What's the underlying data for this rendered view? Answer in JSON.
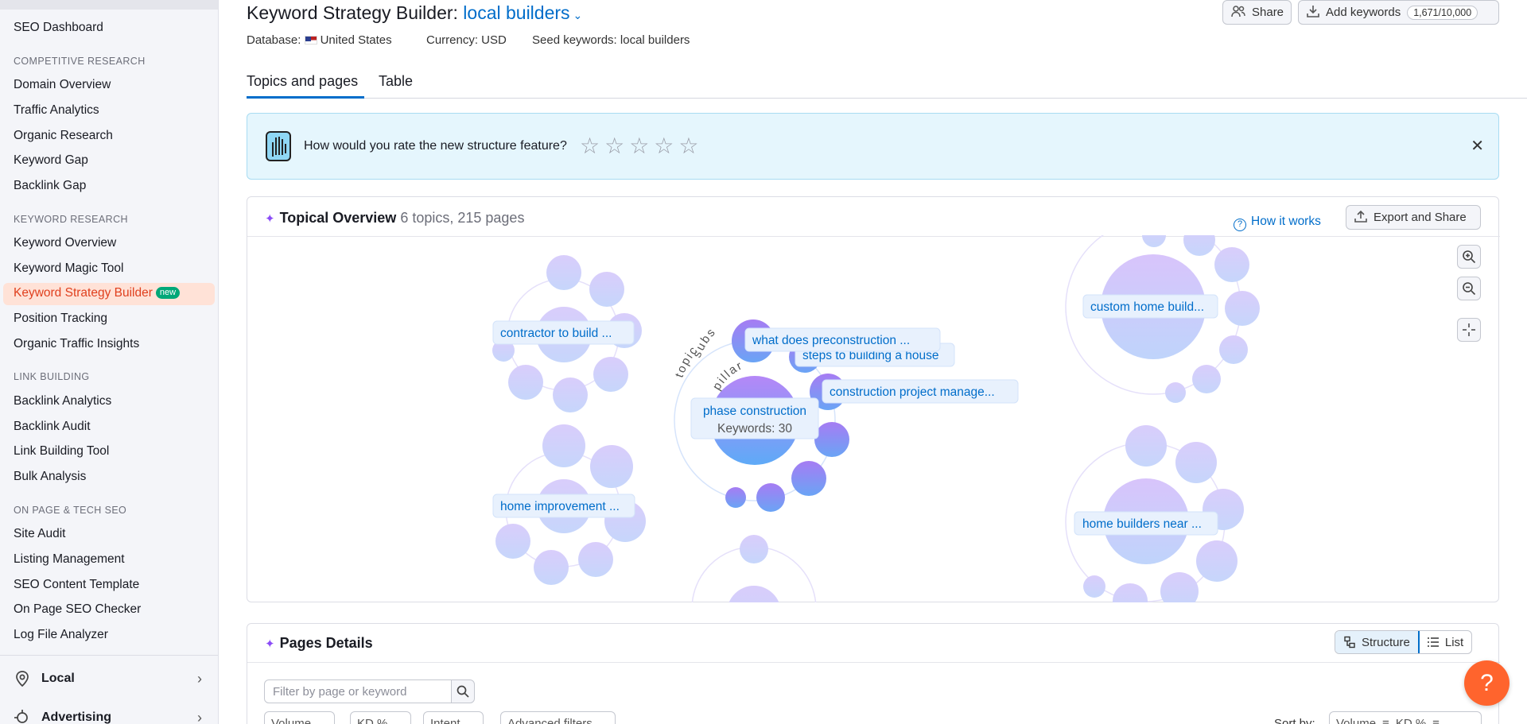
{
  "sidebar": {
    "dashboard": "SEO Dashboard",
    "sections": {
      "competitive": "COMPETITIVE RESEARCH",
      "keyword": "KEYWORD RESEARCH",
      "link": "LINK BUILDING",
      "onpage": "ON PAGE & TECH SEO"
    },
    "competitive_items": [
      "Domain Overview",
      "Traffic Analytics",
      "Organic Research",
      "Keyword Gap",
      "Backlink Gap"
    ],
    "keyword_items": [
      "Keyword Overview",
      "Keyword Magic Tool",
      "Keyword Strategy Builder",
      "Position Tracking",
      "Organic Traffic Insights"
    ],
    "new_badge": "new",
    "link_items": [
      "Backlink Analytics",
      "Backlink Audit",
      "Link Building Tool",
      "Bulk Analysis"
    ],
    "onpage_items": [
      "Site Audit",
      "Listing Management",
      "SEO Content Template",
      "On Page SEO Checker",
      "Log File Analyzer"
    ],
    "groups": [
      "Local",
      "Advertising"
    ]
  },
  "header": {
    "title": "Keyword Strategy Builder:",
    "seed": "local builders",
    "database_label": "Database:",
    "database_value": "United States",
    "currency": "Currency: USD",
    "seed_keywords": "Seed keywords: local builders",
    "share": "Share",
    "add_keywords": "Add keywords",
    "keyword_count": "1,671/10,000"
  },
  "tabs": [
    "Topics and pages",
    "Table"
  ],
  "banner": {
    "question": "How would you rate the new structure feature?",
    "stars": "☆☆☆☆☆"
  },
  "overview": {
    "title": "Topical Overview",
    "subtitle": "6 topics, 215 pages",
    "how_it_works": "How it works",
    "export": "Export and Share",
    "labels": {
      "contractor": "contractor to build ...",
      "home_improvement": "home improvement ...",
      "custom_home": "custom home build...",
      "home_builders_near": "home builders near ...",
      "what_does": "what does preconstruction ...",
      "steps": "steps to building a house",
      "construction_pm": "construction project manage...",
      "phase": "phase construction",
      "phase_keywords": "Keywords: 30",
      "arc_subs": "subs",
      "arc_topic": "topic",
      "arc_pillar": "pillar"
    }
  },
  "pages_details": {
    "title": "Pages Details",
    "structure": "Structure",
    "list": "List",
    "filter_placeholder": "Filter by page or keyword",
    "filters": [
      "Volume",
      "KD %",
      "Intent",
      "Advanced filters"
    ],
    "sort_by": "Sort by:",
    "sort_value": "Volume",
    "sort_secondary": "KD %"
  },
  "help": "?",
  "colors": {
    "accent": "#006dca",
    "active_nav": "#e0401e",
    "help": "#ff642d"
  }
}
